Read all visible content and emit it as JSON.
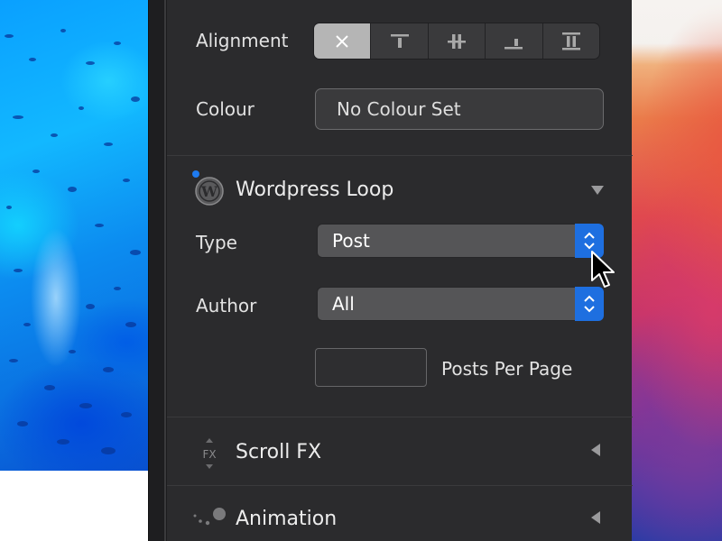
{
  "alignment": {
    "label": "Alignment",
    "options": [
      {
        "icon": "close-icon",
        "active": true
      },
      {
        "icon": "align-top-icon",
        "active": false
      },
      {
        "icon": "align-vertical-center-icon",
        "active": false
      },
      {
        "icon": "align-bottom-icon",
        "active": false
      },
      {
        "icon": "stretch-vertical-icon",
        "active": false
      }
    ]
  },
  "colour": {
    "label": "Colour",
    "button_label": "No Colour Set"
  },
  "wordpress_loop": {
    "title": "Wordpress Loop",
    "icon": "wordpress-icon",
    "type": {
      "label": "Type",
      "value": "Post"
    },
    "author": {
      "label": "Author",
      "value": "All"
    },
    "posts_per_page": {
      "label": "Posts Per Page",
      "value": ""
    }
  },
  "scroll_fx": {
    "title": "Scroll FX",
    "icon": "scroll-fx-icon"
  },
  "animation": {
    "title": "Animation",
    "icon": "animation-icon"
  },
  "colors": {
    "panel_bg": "#2b2b2d",
    "accent_blue": "#1e6fe0",
    "select_bg": "#555557"
  }
}
